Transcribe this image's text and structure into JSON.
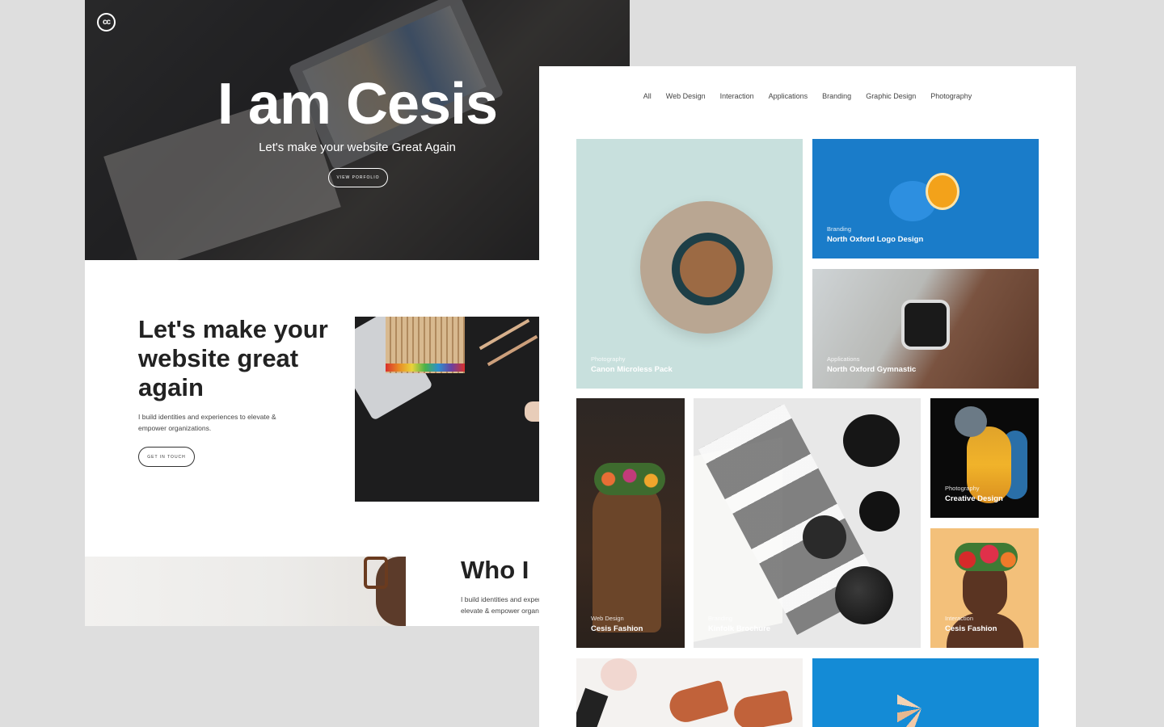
{
  "hero": {
    "logo_text": "cc",
    "title": "I am Cesis",
    "subtitle": "Let's make your website Great Again",
    "button_label": "VIEW PORFOLIO"
  },
  "intro": {
    "title": "Let's make your website great again",
    "text": "I build identities and experiences to elevate & empower organizations.",
    "button_label": "GET IN TOUCH"
  },
  "who": {
    "title": "Who I",
    "text_line1": "I build identities and exper",
    "text_line2": "elevate & empower organiz"
  },
  "portfolio": {
    "filters": [
      "All",
      "Web Design",
      "Interaction",
      "Applications",
      "Branding",
      "Graphic Design",
      "Photography"
    ],
    "items": [
      {
        "category": "Photography",
        "name": "Canon Microless Pack"
      },
      {
        "category": "Branding",
        "name": "North Oxford Logo Design"
      },
      {
        "category": "Applications",
        "name": "North Oxford Gymnastic"
      },
      {
        "category": "Web Design",
        "name": "Cesis Fashion"
      },
      {
        "category": "Branding",
        "name": "Kinfolk Brochure"
      },
      {
        "category": "Photography",
        "name": "Creative Design"
      },
      {
        "category": "Interaction",
        "name": "Cesis Fashion"
      }
    ]
  }
}
